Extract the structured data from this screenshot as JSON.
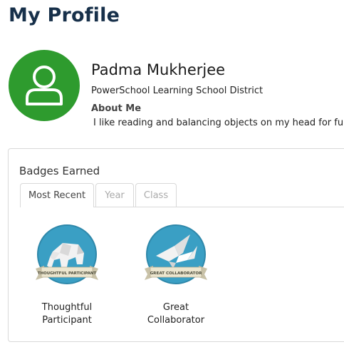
{
  "page": {
    "title": "My Profile"
  },
  "profile": {
    "name": "Padma Mukherjee",
    "school": "PowerSchool Learning School District",
    "about_heading": "About Me",
    "about_text": "I like reading and balancing objects on my head for fun.",
    "avatar_icon": "user-icon",
    "avatar_color": "#2e9b2e"
  },
  "badges": {
    "heading": "Badges Earned",
    "tabs": [
      {
        "label": "Most Recent",
        "active": true
      },
      {
        "label": "Year",
        "active": false
      },
      {
        "label": "Class",
        "active": false
      }
    ],
    "items": [
      {
        "label": "Thoughtful Participant",
        "ribbon": "THOUGHTFUL PARTICIPANT",
        "icon": "elephant-icon"
      },
      {
        "label": "Great Collaborator",
        "ribbon": "GREAT COLLABORATOR",
        "icon": "paper-crane-icon"
      }
    ],
    "badge_color": "#3a9fc4"
  }
}
